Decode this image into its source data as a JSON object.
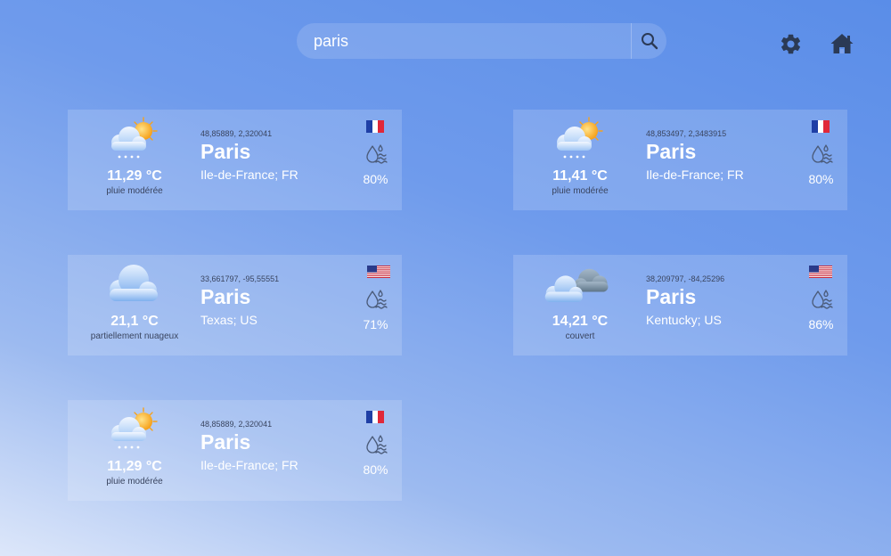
{
  "search": {
    "value": "paris",
    "placeholder": ""
  },
  "toolbar": {
    "settings_icon": "gear-icon",
    "home_icon": "home-icon"
  },
  "cards": [
    {
      "coords": "48,85889, 2,320041",
      "city": "Paris",
      "region": "Ile-de-France; FR",
      "temp": "11,29 °C",
      "desc": "pluie modérée",
      "humidity": "80%",
      "weather_icon": "sun-cloud-rain-icon",
      "flag": "france-flag-icon"
    },
    {
      "coords": "48,853497, 2,3483915",
      "city": "Paris",
      "region": "Ile-de-France; FR",
      "temp": "11,41 °C",
      "desc": "pluie modérée",
      "humidity": "80%",
      "weather_icon": "sun-cloud-rain-icon",
      "flag": "france-flag-icon"
    },
    {
      "coords": "33,661797, -95,55551",
      "city": "Paris",
      "region": "Texas; US",
      "temp": "21,1 °C",
      "desc": "partiellement nuageux",
      "humidity": "71%",
      "weather_icon": "cloud-icon",
      "flag": "us-flag-icon"
    },
    {
      "coords": "38,209797, -84,25296",
      "city": "Paris",
      "region": "Kentucky; US",
      "temp": "14,21 °C",
      "desc": "couvert",
      "humidity": "86%",
      "weather_icon": "overcast-clouds-icon",
      "flag": "us-flag-icon"
    },
    {
      "coords": "48,85889, 2,320041",
      "city": "Paris",
      "region": "Ile-de-France; FR",
      "temp": "11,29 °C",
      "desc": "pluie modérée",
      "humidity": "80%",
      "weather_icon": "sun-cloud-rain-icon",
      "flag": "france-flag-icon"
    }
  ],
  "colors": {
    "card_text": "#ffffff",
    "muted_text": "#3a4560",
    "icon_dark": "#2b3a55",
    "sun": "#f7b52c"
  }
}
